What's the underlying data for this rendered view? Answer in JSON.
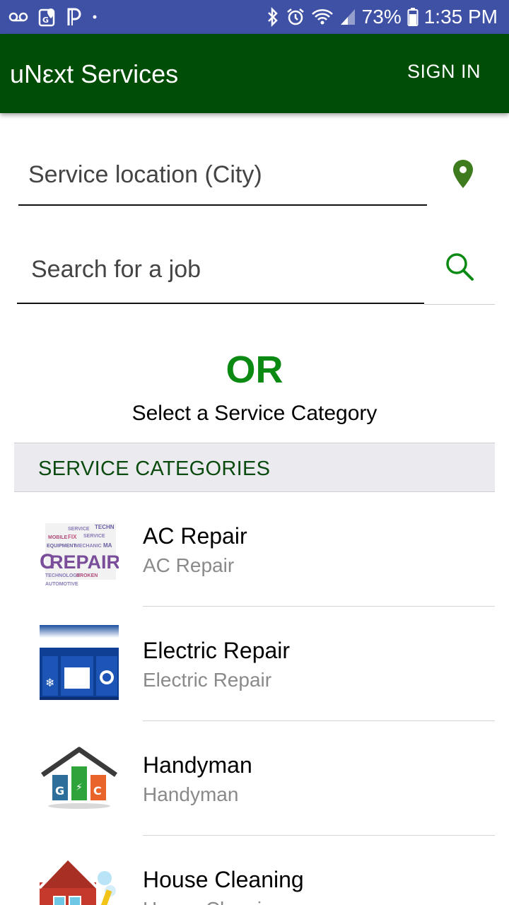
{
  "status_bar": {
    "battery": "73%",
    "time": "1:35 PM"
  },
  "app_bar": {
    "title": "uNεxt Services",
    "sign_in": "SIGN IN"
  },
  "location": {
    "placeholder": "Service location (City)"
  },
  "search": {
    "placeholder": "Search for a job"
  },
  "or_text": "OR",
  "select_text": "Select a Service Category",
  "categories_header": "SERVICE CATEGORIES",
  "categories": [
    {
      "title": "AC Repair",
      "subtitle": "AC Repair"
    },
    {
      "title": "Electric Repair",
      "subtitle": "Electric Repair"
    },
    {
      "title": "Handyman",
      "subtitle": "Handyman"
    },
    {
      "title": "House Cleaning",
      "subtitle": "House Cleaning"
    }
  ],
  "colors": {
    "status_bar": "#3f51a5",
    "app_bar": "#004d06",
    "accent_green": "#0a8a12"
  },
  "icons": [
    "voicemail-icon",
    "maps-icon",
    "pandora-icon",
    "bluetooth-icon",
    "alarm-icon",
    "wifi-icon",
    "signal-icon",
    "battery-icon",
    "location-pin-icon",
    "search-icon"
  ]
}
